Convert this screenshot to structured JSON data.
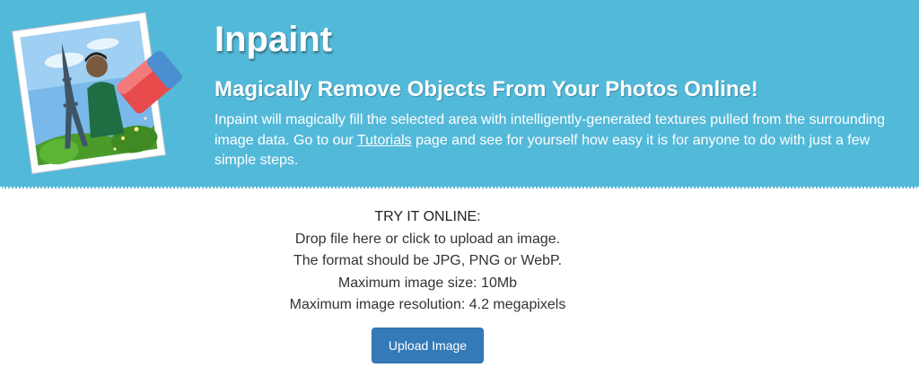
{
  "header": {
    "title": "Inpaint",
    "subtitle": "Magically Remove Objects From Your Photos Online!",
    "description_before_link": "Inpaint will magically fill the selected area with intelligently-generated textures pulled from the surrounding image data. Go to our ",
    "link_text": "Tutorials",
    "description_after_link": " page and see for yourself how easy it is for anyone to do with just a few simple steps.",
    "background_color": "#53b9d9",
    "logo_icon": "photo-with-eraser-icon"
  },
  "upload": {
    "heading": "TRY IT ONLINE:",
    "lines": [
      "Drop file here or click to upload an image.",
      "The format should be JPG, PNG or WebP.",
      "Maximum image size: 10Mb",
      "Maximum image resolution: 4.2 megapixels"
    ],
    "button_label": "Upload Image",
    "button_color": "#337ab7"
  }
}
